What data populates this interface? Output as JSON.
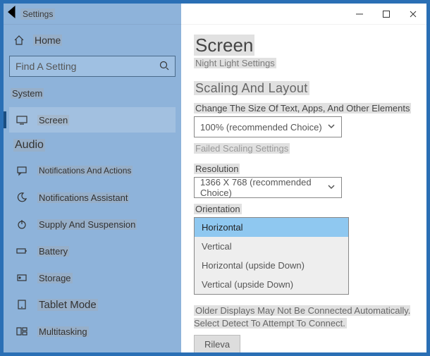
{
  "window": {
    "title": "Settings"
  },
  "sidebar": {
    "home": "Home",
    "search_placeholder": "Find A Setting",
    "category1": "System",
    "items": [
      {
        "label": "Screen",
        "icon": "monitor-icon",
        "active": true
      },
      {
        "label": "Audio",
        "icon": "speaker-icon"
      },
      {
        "label": "Notifications And Actions",
        "icon": "message-icon"
      },
      {
        "label": "Notifications Assistant",
        "icon": "moon-icon"
      },
      {
        "label": "Supply And Suspension",
        "icon": "power-icon"
      },
      {
        "label": "Battery",
        "icon": "battery-icon"
      },
      {
        "label": "Storage",
        "icon": "storage-icon"
      },
      {
        "label": "Tablet Mode",
        "icon": "tablet-icon"
      },
      {
        "label": "Multitasking",
        "icon": "multitask-icon"
      }
    ]
  },
  "main": {
    "title": "Screen",
    "subtitle": "Night Light Settings",
    "section1": "Scaling And Layout",
    "scale_label": "Change The Size Of Text, Apps, And Other Elements",
    "scale_value": "100% (recommended Choice)",
    "advanced_scaling": "Failed Scaling Settings",
    "resolution_label": "Resolution",
    "resolution_value": "1366 X 768 (recommended Choice)",
    "orientation_label": "Orientation",
    "orientation_options": {
      "o0": "Horizontal",
      "o1": "Vertical",
      "o2": "Horizontal (upside Down)",
      "o3": "Vertical (upside Down)"
    },
    "note": "Older Displays May Not Be Connected Automatically. Select Detect To Attempt To Connect.",
    "detect_button": "Rileva"
  }
}
